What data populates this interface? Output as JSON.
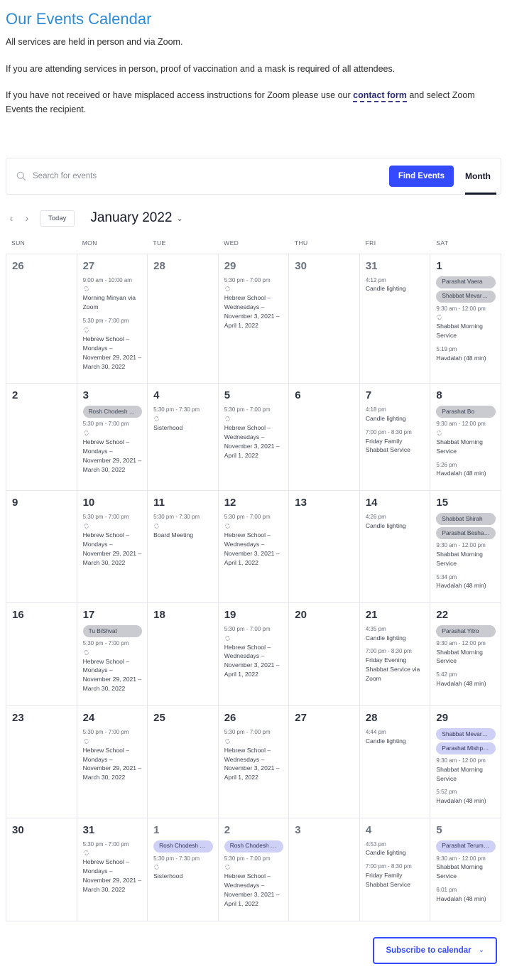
{
  "intro": {
    "title": "Our Events Calendar",
    "p1": "All services are held in person and via Zoom.",
    "p2": "If you are attending services in person, proof of vaccination and a mask is required of all attendees.",
    "p3_before": "If you have not received or have misplaced access instructions for Zoom please use our ",
    "p3_link": "contact form",
    "p3_after": " and select Zoom Events the recipient."
  },
  "search": {
    "placeholder": "Search for events",
    "value": "",
    "find_label": "Find Events",
    "view_label": "Month"
  },
  "nav": {
    "prev": "‹",
    "next": "›",
    "today_label": "Today",
    "month_title": "January 2022",
    "caret": "⌄"
  },
  "weekdays": [
    "SUN",
    "MON",
    "TUE",
    "WED",
    "THU",
    "FRI",
    "SAT"
  ],
  "colors": {
    "accent": "#334aff",
    "title": "#2b8bd4",
    "pill_gray": "#c9cbd1",
    "pill_lavender": "#cfd0f5"
  },
  "footer": {
    "subscribe_label": "Subscribe to calendar",
    "caret": "⌄"
  },
  "calendar": {
    "weeks": [
      [
        {
          "day": "26",
          "other": true,
          "pills": [],
          "events": []
        },
        {
          "day": "27",
          "other": true,
          "pills": [],
          "events": [
            {
              "time": "9:00 am - 10:00 am",
              "recur": true,
              "title": "Morning Minyan via Zoom"
            },
            {
              "time": "5:30 pm - 7:00 pm",
              "recur": true,
              "title": "Hebrew School – Mondays – November 29, 2021 – March 30, 2022"
            }
          ]
        },
        {
          "day": "28",
          "other": true,
          "pills": [],
          "events": []
        },
        {
          "day": "29",
          "other": true,
          "pills": [],
          "events": [
            {
              "time": "5:30 pm - 7:00 pm",
              "recur": true,
              "title": "Hebrew School – Wednesdays – November 3, 2021 – April 1, 2022"
            }
          ]
        },
        {
          "day": "30",
          "other": true,
          "pills": [],
          "events": []
        },
        {
          "day": "31",
          "other": true,
          "pills": [],
          "events": [
            {
              "time": "4:12 pm",
              "recur": false,
              "title": "Candle lighting"
            }
          ]
        },
        {
          "day": "1",
          "other": false,
          "pills": [
            {
              "text": "Parashat Vaera",
              "style": "gray"
            },
            {
              "text": "Shabbat Mevarc…",
              "style": "gray"
            }
          ],
          "events": [
            {
              "time": "9:30 am - 12:00 pm",
              "recur": true,
              "title": "Shabbat Morning Service"
            },
            {
              "time": "5:19 pm",
              "recur": false,
              "title": "Havdalah (48 min)"
            }
          ]
        }
      ],
      [
        {
          "day": "2",
          "other": false,
          "pills": [],
          "events": []
        },
        {
          "day": "3",
          "other": false,
          "pills": [
            {
              "text": "Rosh Chodesh S…",
              "style": "gray"
            }
          ],
          "events": [
            {
              "time": "5:30 pm - 7:00 pm",
              "recur": true,
              "title": "Hebrew School – Mondays – November 29, 2021 – March 30, 2022"
            }
          ]
        },
        {
          "day": "4",
          "other": false,
          "pills": [],
          "events": [
            {
              "time": "5:30 pm - 7:30 pm",
              "recur": true,
              "title": "Sisterhood"
            }
          ]
        },
        {
          "day": "5",
          "other": false,
          "pills": [],
          "events": [
            {
              "time": "5:30 pm - 7:00 pm",
              "recur": true,
              "title": "Hebrew School – Wednesdays – November 3, 2021 – April 1, 2022"
            }
          ]
        },
        {
          "day": "6",
          "other": false,
          "pills": [],
          "events": []
        },
        {
          "day": "7",
          "other": false,
          "pills": [],
          "events": [
            {
              "time": "4:18 pm",
              "recur": false,
              "title": "Candle lighting"
            },
            {
              "time": "7:00 pm - 8:30 pm",
              "recur": false,
              "title": "Friday Family Shabbat Service"
            }
          ]
        },
        {
          "day": "8",
          "other": false,
          "pills": [
            {
              "text": "Parashat Bo",
              "style": "gray"
            }
          ],
          "events": [
            {
              "time": "9:30 am - 12:00 pm",
              "recur": true,
              "title": "Shabbat Morning Service"
            },
            {
              "time": "5:26 pm",
              "recur": false,
              "title": "Havdalah (48 min)"
            }
          ]
        }
      ],
      [
        {
          "day": "9",
          "other": false,
          "pills": [],
          "events": []
        },
        {
          "day": "10",
          "other": false,
          "pills": [],
          "events": [
            {
              "time": "5:30 pm - 7:00 pm",
              "recur": true,
              "title": "Hebrew School – Mondays – November 29, 2021 – March 30, 2022"
            }
          ]
        },
        {
          "day": "11",
          "other": false,
          "pills": [],
          "events": [
            {
              "time": "5:30 pm - 7:30 pm",
              "recur": true,
              "title": "Board Meeting"
            }
          ]
        },
        {
          "day": "12",
          "other": false,
          "pills": [],
          "events": [
            {
              "time": "5:30 pm - 7:00 pm",
              "recur": true,
              "title": "Hebrew School – Wednesdays – November 3, 2021 – April 1, 2022"
            }
          ]
        },
        {
          "day": "13",
          "other": false,
          "pills": [],
          "events": []
        },
        {
          "day": "14",
          "other": false,
          "pills": [],
          "events": [
            {
              "time": "4:26 pm",
              "recur": false,
              "title": "Candle lighting"
            }
          ]
        },
        {
          "day": "15",
          "other": false,
          "pills": [
            {
              "text": "Shabbat Shirah",
              "style": "gray"
            },
            {
              "text": "Parashat Beshalach",
              "style": "gray"
            }
          ],
          "events": [
            {
              "time": "9:30 am - 12:00 pm",
              "recur": false,
              "title": "Shabbat Morning Service"
            },
            {
              "time": "5:34 pm",
              "recur": false,
              "title": "Havdalah (48 min)"
            }
          ]
        }
      ],
      [
        {
          "day": "16",
          "other": false,
          "pills": [],
          "events": []
        },
        {
          "day": "17",
          "other": false,
          "pills": [
            {
              "text": "Tu BiShvat",
              "style": "gray"
            }
          ],
          "events": [
            {
              "time": "5:30 pm - 7:00 pm",
              "recur": true,
              "title": "Hebrew School – Mondays – November 29, 2021 – March 30, 2022"
            }
          ]
        },
        {
          "day": "18",
          "other": false,
          "pills": [],
          "events": []
        },
        {
          "day": "19",
          "other": false,
          "pills": [],
          "events": [
            {
              "time": "5:30 pm - 7:00 pm",
              "recur": true,
              "title": "Hebrew School – Wednesdays – November 3, 2021 – April 1, 2022"
            }
          ]
        },
        {
          "day": "20",
          "other": false,
          "pills": [],
          "events": []
        },
        {
          "day": "21",
          "other": false,
          "pills": [],
          "events": [
            {
              "time": "4:35 pm",
              "recur": false,
              "title": "Candle lighting"
            },
            {
              "time": "7:00 pm - 8:30 pm",
              "recur": false,
              "title": "Friday Evening Shabbat Service via Zoom"
            }
          ]
        },
        {
          "day": "22",
          "other": false,
          "pills": [
            {
              "text": "Parashat Yitro",
              "style": "gray"
            }
          ],
          "events": [
            {
              "time": "9:30 am - 12:00 pm",
              "recur": false,
              "title": "Shabbat Morning Service"
            },
            {
              "time": "5:42 pm",
              "recur": false,
              "title": "Havdalah (48 min)"
            }
          ]
        }
      ],
      [
        {
          "day": "23",
          "other": false,
          "pills": [],
          "events": []
        },
        {
          "day": "24",
          "other": false,
          "pills": [],
          "events": [
            {
              "time": "5:30 pm - 7:00 pm",
              "recur": true,
              "title": "Hebrew School – Mondays – November 29, 2021 – March 30, 2022"
            }
          ]
        },
        {
          "day": "25",
          "other": false,
          "pills": [],
          "events": []
        },
        {
          "day": "26",
          "other": false,
          "pills": [],
          "events": [
            {
              "time": "5:30 pm - 7:00 pm",
              "recur": true,
              "title": "Hebrew School – Wednesdays – November 3, 2021 – April 1, 2022"
            }
          ]
        },
        {
          "day": "27",
          "other": false,
          "pills": [],
          "events": []
        },
        {
          "day": "28",
          "other": false,
          "pills": [],
          "events": [
            {
              "time": "4:44 pm",
              "recur": false,
              "title": "Candle lighting"
            }
          ]
        },
        {
          "day": "29",
          "other": false,
          "pills": [
            {
              "text": "Shabbat Mevarc…",
              "style": "lav"
            },
            {
              "text": "Parashat Mishpatim",
              "style": "lav"
            }
          ],
          "events": [
            {
              "time": "9:30 am - 12:00 pm",
              "recur": false,
              "title": "Shabbat Morning Service"
            },
            {
              "time": "5:52 pm",
              "recur": false,
              "title": "Havdalah (48 min)"
            }
          ]
        }
      ],
      [
        {
          "day": "30",
          "other": false,
          "pills": [],
          "events": []
        },
        {
          "day": "31",
          "other": false,
          "pills": [],
          "events": [
            {
              "time": "5:30 pm - 7:00 pm",
              "recur": true,
              "title": "Hebrew School – Mondays – November 29, 2021 – March 30, 2022"
            }
          ]
        },
        {
          "day": "1",
          "other": true,
          "pills": [
            {
              "text": "Rosh Chodesh A…",
              "style": "lav"
            }
          ],
          "events": [
            {
              "time": "5:30 pm - 7:30 pm",
              "recur": true,
              "title": "Sisterhood"
            }
          ]
        },
        {
          "day": "2",
          "other": true,
          "pills": [
            {
              "text": "Rosh Chodesh A…",
              "style": "lav"
            }
          ],
          "events": [
            {
              "time": "5:30 pm - 7:00 pm",
              "recur": true,
              "title": "Hebrew School – Wednesdays – November 3, 2021 – April 1, 2022"
            }
          ]
        },
        {
          "day": "3",
          "other": true,
          "pills": [],
          "events": []
        },
        {
          "day": "4",
          "other": true,
          "pills": [],
          "events": [
            {
              "time": "4:53 pm",
              "recur": false,
              "title": "Candle lighting"
            },
            {
              "time": "7:00 pm - 8:30 pm",
              "recur": false,
              "title": "Friday Family Shabbat Service"
            }
          ]
        },
        {
          "day": "5",
          "other": true,
          "pills": [
            {
              "text": "Parashat Terumah",
              "style": "lav"
            }
          ],
          "events": [
            {
              "time": "9:30 am - 12:00 pm",
              "recur": false,
              "title": "Shabbat Morning Service"
            },
            {
              "time": "6:01 pm",
              "recur": false,
              "title": "Havdalah (48 min)"
            }
          ]
        }
      ]
    ]
  }
}
